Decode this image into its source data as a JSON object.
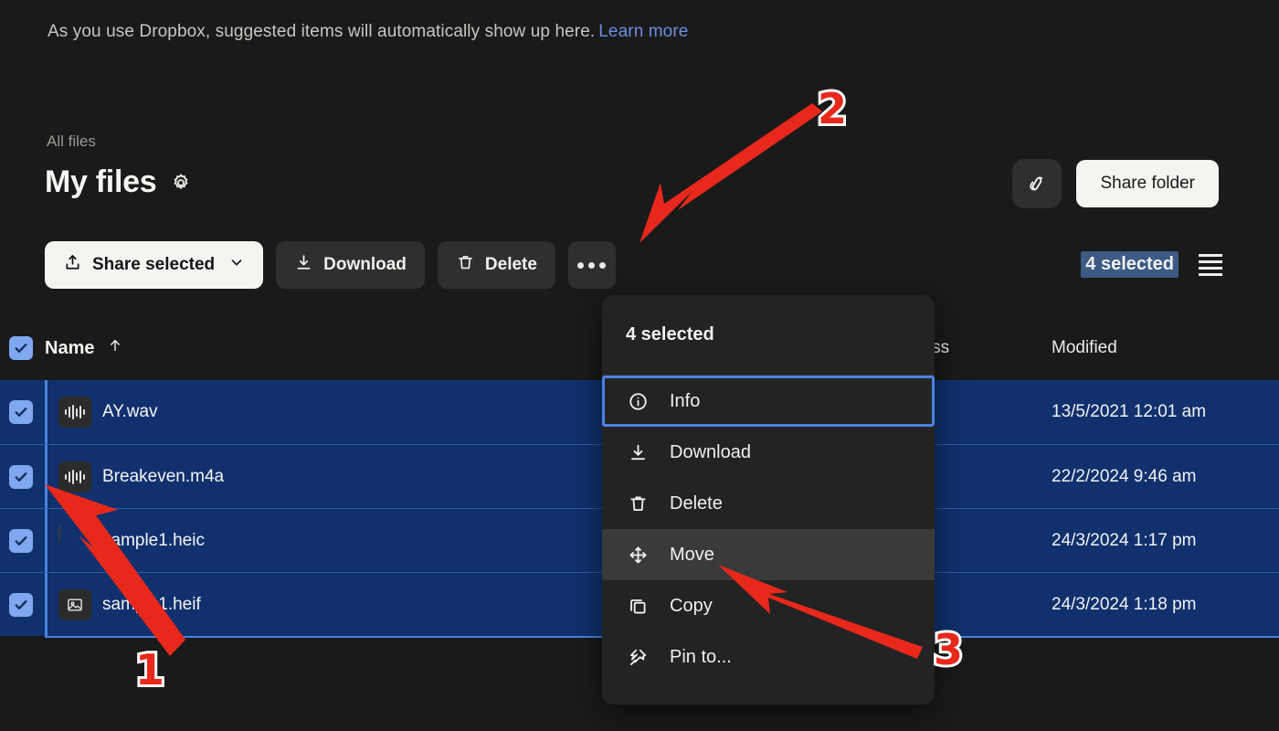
{
  "banner": {
    "text": "As you use Dropbox, suggested items will automatically show up here.",
    "link_label": "Learn more"
  },
  "header": {
    "breadcrumb": "All files",
    "title": "My files",
    "settings_icon": "gear-icon",
    "link_icon": "link-icon",
    "share_folder_label": "Share folder"
  },
  "toolbar": {
    "share_selected_label": "Share selected",
    "share_chevron_icon": "chevron-down-icon",
    "share_icon": "share-upload-icon",
    "download_label": "Download",
    "download_icon": "download-icon",
    "delete_label": "Delete",
    "delete_icon": "trash-icon",
    "more_icon": "ellipsis-icon",
    "selected_count_label": "4 selected",
    "view_icon": "list-view-icon"
  },
  "table": {
    "columns": {
      "name": "Name",
      "sort_icon": "arrow-up-icon",
      "access": "cess",
      "modified": "Modified"
    },
    "select_all_checked": true,
    "rows": [
      {
        "name": "AY.wav",
        "icon": "audio-waveform-icon",
        "modified": "13/5/2021 12:01 am",
        "checked": true
      },
      {
        "name": "Breakeven.m4a",
        "icon": "audio-waveform-icon",
        "modified": "22/2/2024 9:46 am",
        "checked": true
      },
      {
        "name": "sample1.heic",
        "icon": "photo-thumbnail",
        "modified": "24/3/2024 1:17 pm",
        "checked": true
      },
      {
        "name": "sample1.heif",
        "icon": "image-placeholder-icon",
        "modified": "24/3/2024 1:18 pm",
        "checked": true
      }
    ]
  },
  "menu": {
    "header_label": "4 selected",
    "items": [
      {
        "label": "Info",
        "icon": "info-circle-icon",
        "state": "focus"
      },
      {
        "label": "Download",
        "icon": "download-icon",
        "state": ""
      },
      {
        "label": "Delete",
        "icon": "trash-icon",
        "state": ""
      },
      {
        "label": "Move",
        "icon": "move-arrows-icon",
        "state": "hover"
      },
      {
        "label": "Copy",
        "icon": "copy-icon",
        "state": ""
      },
      {
        "label": "Pin to...",
        "icon": "pin-icon",
        "state": ""
      }
    ]
  },
  "annotations": {
    "markers": [
      {
        "label": "1"
      },
      {
        "label": "2"
      },
      {
        "label": "3"
      }
    ],
    "arrow_color": "#e8281b"
  },
  "colors": {
    "page_bg": "#1a1a1a",
    "row_selected": "#10316e",
    "accent_blue": "#4a82e0",
    "checkbox": "#7fa8f0",
    "menu_bg": "#232323",
    "link": "#6a8ee0",
    "annotation_red": "#e8281b"
  }
}
